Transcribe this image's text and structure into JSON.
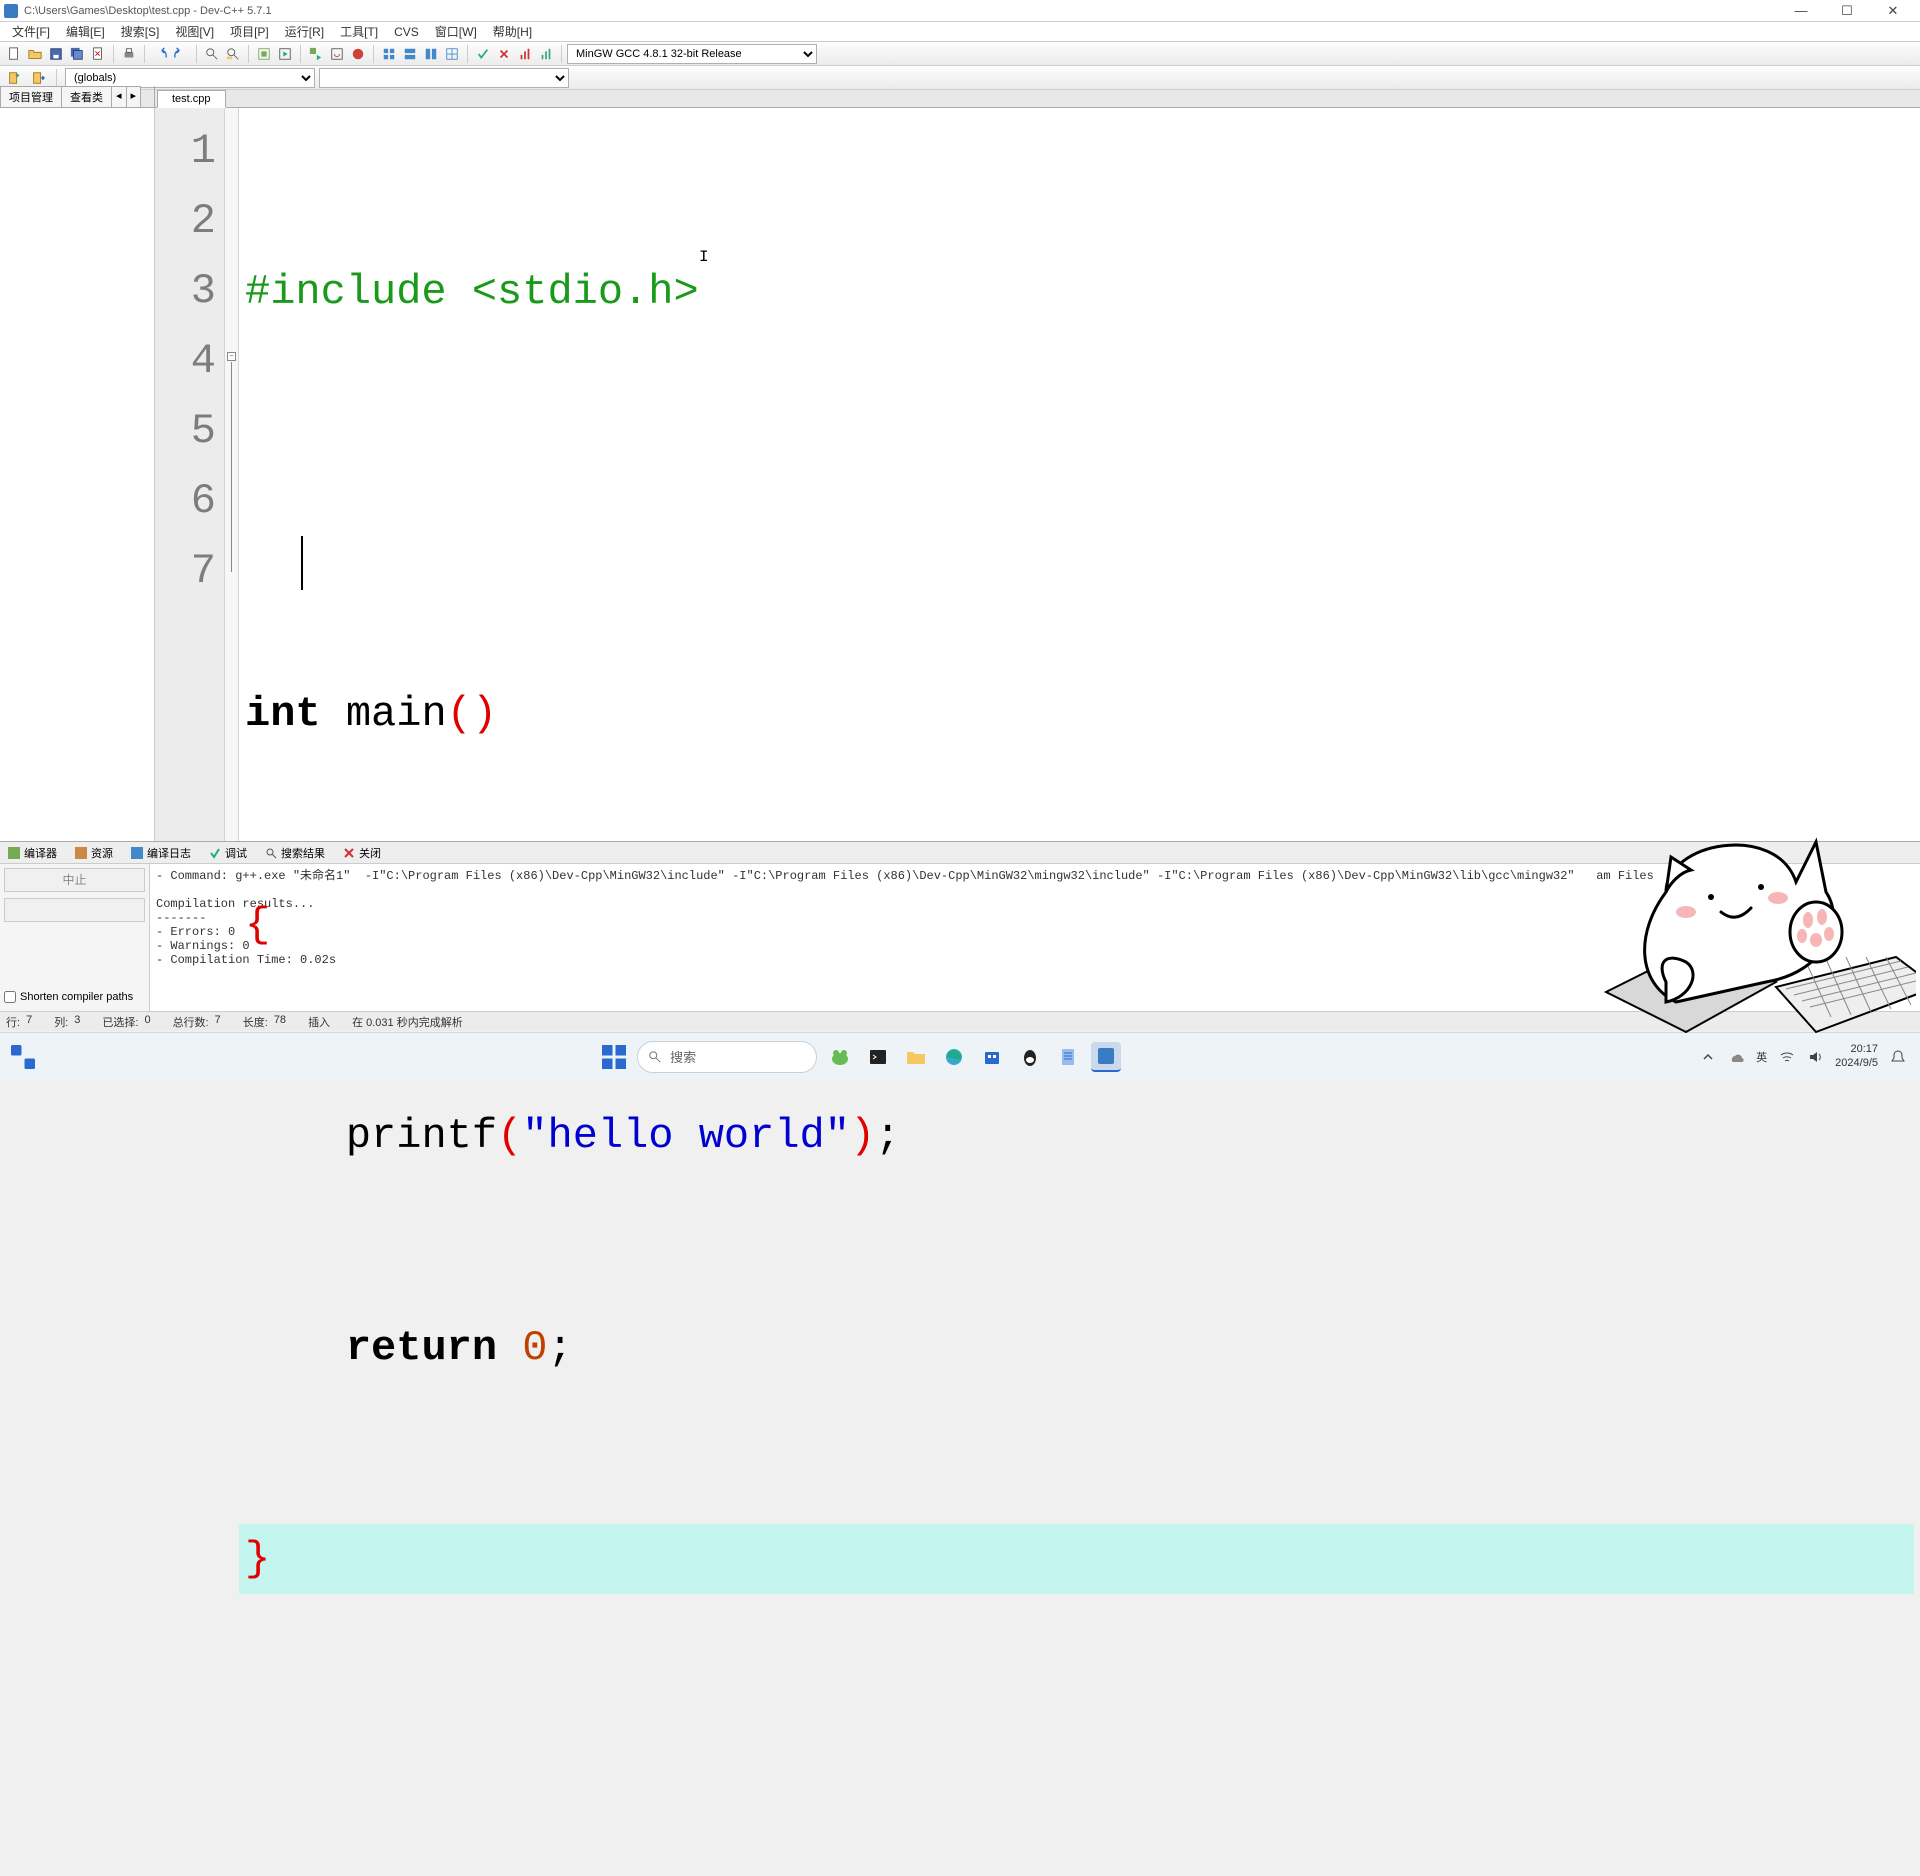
{
  "title": "C:\\Users\\Games\\Desktop\\test.cpp - Dev-C++ 5.7.1",
  "menu": [
    "文件[F]",
    "编辑[E]",
    "搜索[S]",
    "视图[V]",
    "项目[P]",
    "运行[R]",
    "工具[T]",
    "CVS",
    "窗口[W]",
    "帮助[H]"
  ],
  "scope_select": "(globals)",
  "compiler_select": "MinGW GCC 4.8.1 32-bit Release",
  "left_tabs": [
    "项目管理",
    "查看类"
  ],
  "file_tab": "test.cpp",
  "lines": [
    "1",
    "2",
    "3",
    "4",
    "5",
    "6",
    "7"
  ],
  "output_tabs": [
    "编译器",
    "资源",
    "编译日志",
    "调试",
    "搜索结果",
    "关闭"
  ],
  "btn_abort": "中止",
  "chk_shorten": "Shorten compiler paths",
  "log": "- Command: g++.exe \"未命名1\"  -I\"C:\\Program Files (x86)\\Dev-Cpp\\MinGW32\\include\" -I\"C:\\Program Files (x86)\\Dev-Cpp\\MinGW32\\mingw32\\include\" -I\"C:\\Program Files (x86)\\Dev-Cpp\\MinGW32\\lib\\gcc\\mingw32\"   am Files\n\nCompilation results...\n-------\n- Errors: 0\n- Warnings: 0\n- Compilation Time: 0.02s",
  "status": {
    "line_lbl": "行:",
    "line": "7",
    "col_lbl": "列:",
    "col": "3",
    "sel_lbl": "已选择:",
    "sel": "0",
    "total_lbl": "总行数:",
    "total": "7",
    "len_lbl": "长度:",
    "len": "78",
    "ins": "插入",
    "parse": "在 0.031 秒内完成解析"
  },
  "taskbar": {
    "search_placeholder": "搜索",
    "ime": "英",
    "time": "20:17",
    "date": "2024/9/5"
  },
  "code": {
    "l1_include": "#include <stdio.h>",
    "l3_int": "int",
    "l3_main": " main",
    "l3_paren": "()",
    "l4_brace": "{",
    "l5_indent": "    ",
    "l5_printf": "printf",
    "l5_p1": "(",
    "l5_str": "\"hello world\"",
    "l5_p2": ")",
    "l5_semi": ";",
    "l6_indent": "    ",
    "l6_return": "return",
    "l6_sp": " ",
    "l6_zero": "0",
    "l6_semi": ";",
    "l7_brace": "}"
  }
}
